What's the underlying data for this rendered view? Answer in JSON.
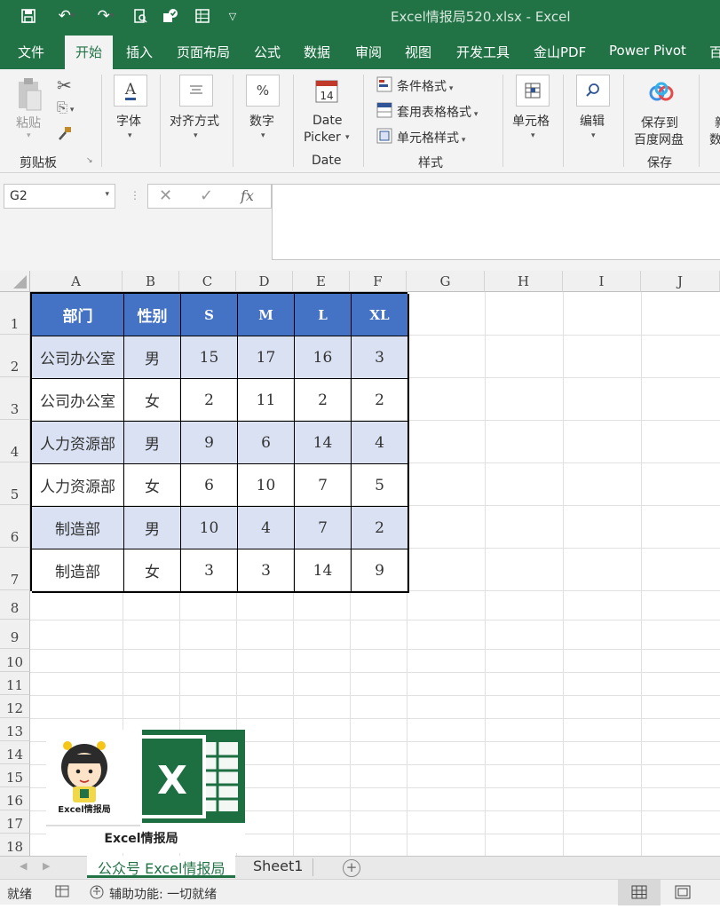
{
  "titlebar": {
    "title": "Excel情报局520.xlsx  -  Excel"
  },
  "tabs": [
    "文件",
    "开始",
    "插入",
    "页面布局",
    "公式",
    "数据",
    "审阅",
    "视图",
    "开发工具",
    "金山PDF",
    "Power Pivot",
    "百"
  ],
  "ribbon": {
    "paste": "粘贴",
    "clipboard_group": "剪贴板",
    "font": "字体",
    "align": "对齐方式",
    "number": "数字",
    "date_picker_line1": "Date",
    "date_picker_line2": "Picker",
    "date_group": "Date",
    "cond_format": "条件格式",
    "table_format": "套用表格格式",
    "cell_style": "单元格样式",
    "style_group": "样式",
    "cells": "单元格",
    "edit": "编辑",
    "save_line1": "保存到",
    "save_line2": "百度网盘",
    "save_group": "保存",
    "cut_a": "新",
    "cut_b": "数"
  },
  "formula_bar": {
    "name_box": "G2",
    "fx": "fx",
    "content": ""
  },
  "columns": [
    "A",
    "B",
    "C",
    "D",
    "E",
    "F",
    "G",
    "H",
    "I",
    "J"
  ],
  "rows": [
    "1",
    "2",
    "3",
    "4",
    "5",
    "6",
    "7",
    "8",
    "9",
    "10",
    "11",
    "12",
    "13",
    "14",
    "15",
    "16",
    "17",
    "18"
  ],
  "table": {
    "headers": [
      "部门",
      "性别",
      "S",
      "M",
      "L",
      "XL"
    ],
    "rows": [
      [
        "公司办公室",
        "男",
        "15",
        "17",
        "16",
        "3"
      ],
      [
        "公司办公室",
        "女",
        "2",
        "11",
        "2",
        "2"
      ],
      [
        "人力资源部",
        "男",
        "9",
        "6",
        "14",
        "4"
      ],
      [
        "人力资源部",
        "女",
        "6",
        "10",
        "7",
        "5"
      ],
      [
        "制造部",
        "男",
        "10",
        "4",
        "7",
        "2"
      ],
      [
        "制造部",
        "女",
        "3",
        "3",
        "14",
        "9"
      ]
    ]
  },
  "logo": {
    "caption": "Excel情报局",
    "small_caption": "Excel情报局"
  },
  "sheets": {
    "active": "公众号 Excel情报局",
    "other": "Sheet1",
    "add": "+"
  },
  "status": {
    "ready": "就绪",
    "accessibility": "辅助功能: 一切就绪"
  },
  "colors": {
    "brand": "#217346",
    "header_fill": "#4472c4",
    "band_fill": "#d9e1f2"
  }
}
